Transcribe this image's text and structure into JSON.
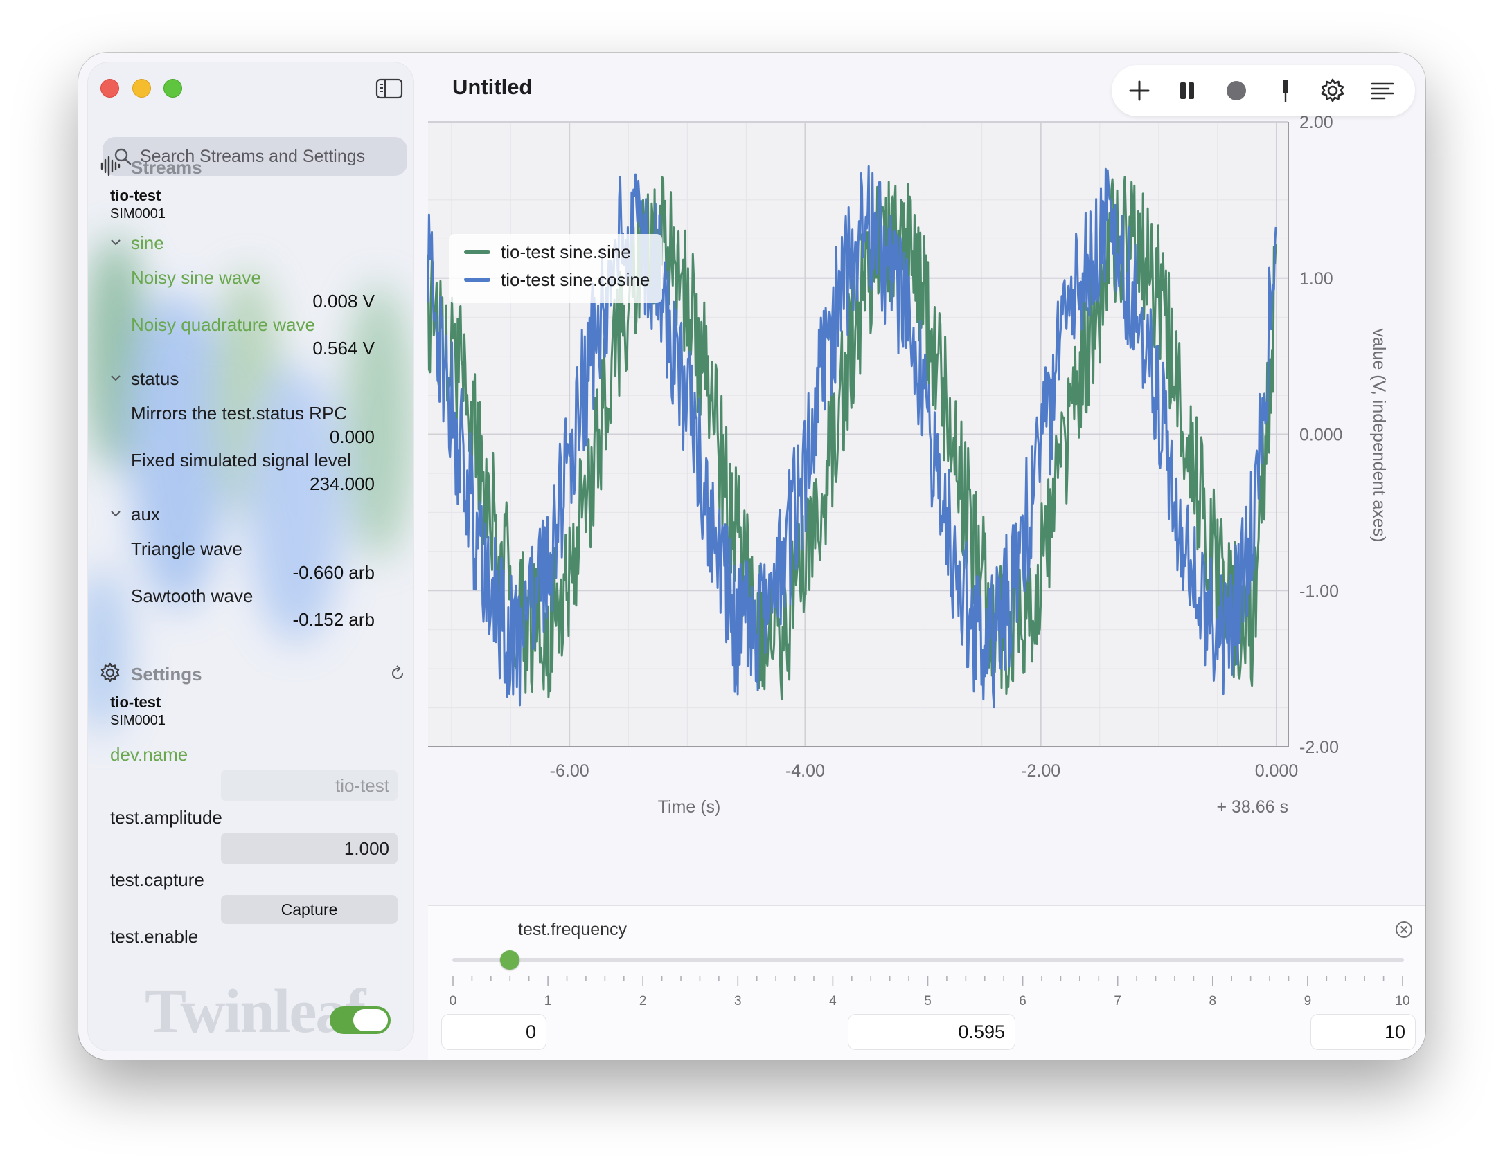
{
  "window": {
    "title": "Untitled"
  },
  "search": {
    "placeholder": "Search Streams and Settings"
  },
  "icons": {
    "sidebar_toggle": "sidebar-toggle-icon",
    "search": "magnifier-icon",
    "streams": "waveform-icon",
    "settings": "gear-icon",
    "refresh": "refresh-icon",
    "add": "plus-icon",
    "pause": "pause-icon",
    "record": "record-icon",
    "probe": "probe-icon",
    "gear": "gear-icon",
    "menu": "lines-icon",
    "close": "close-circle-icon"
  },
  "streams": {
    "heading": "Streams",
    "device_name": "tio-test",
    "device_id": "SIM0001",
    "groups": [
      {
        "name": "sine",
        "expanded": true,
        "items": [
          {
            "label": "Noisy sine wave",
            "value": "0.008 V"
          },
          {
            "label": "Noisy quadrature wave",
            "value": "0.564 V"
          }
        ]
      },
      {
        "name": "status",
        "expanded": true,
        "items": [
          {
            "label": "Mirrors the test.status RPC",
            "value": "0.000"
          },
          {
            "label": "Fixed simulated signal level",
            "value": "234.000"
          }
        ]
      },
      {
        "name": "aux",
        "expanded": true,
        "items": [
          {
            "label": "Triangle wave",
            "value": "-0.660 arb"
          },
          {
            "label": "Sawtooth wave",
            "value": "-0.152 arb"
          }
        ]
      }
    ]
  },
  "settings": {
    "heading": "Settings",
    "device_name": "tio-test",
    "device_id": "SIM0001",
    "fields": [
      {
        "name": "dev.name",
        "value": "tio-test"
      },
      {
        "name": "test.amplitude",
        "value": "1.000"
      },
      {
        "name": "test.capture",
        "button": "Capture"
      },
      {
        "name": "test.enable",
        "toggle": true
      }
    ]
  },
  "watermark": "Twinleaf",
  "colors": {
    "sine": "#4c8a6a",
    "cosine": "#4f7bc8",
    "accent_green": "#6aa84f"
  },
  "chart_data": {
    "type": "line",
    "xlabel": "Time (s)",
    "ylabel": "value (V, independent axes)",
    "x_offset_label": "+ 38.66 s",
    "xlim": [
      -7.2,
      0.1
    ],
    "ylim": [
      -2.0,
      2.0
    ],
    "x_ticks": [
      "-6.00",
      "-4.00",
      "-2.00",
      "0.000"
    ],
    "y_ticks": [
      "2.00",
      "1.00",
      "0.000",
      "-1.00",
      "-2.00"
    ],
    "grid": true,
    "legend_position": "top-left",
    "series": [
      {
        "name": "tio-test sine.sine",
        "color": "#4c8a6a",
        "x": [
          -7.2,
          -7.0,
          -6.8,
          -6.6,
          -6.4,
          -6.2,
          -6.0,
          -5.8,
          -5.6,
          -5.4,
          -5.2,
          -5.0,
          -4.8,
          -4.6,
          -4.4,
          -4.2,
          -4.0,
          -3.8,
          -3.6,
          -3.4,
          -3.2,
          -3.0,
          -2.8,
          -2.6,
          -2.4,
          -2.2,
          -2.0,
          -1.8,
          -1.6,
          -1.4,
          -1.2,
          -1.0,
          -0.8,
          -0.6,
          -0.4,
          -0.2,
          0.0
        ],
        "y": [
          0.8,
          0.6,
          0.0,
          -0.7,
          -1.2,
          -1.3,
          -0.9,
          -0.2,
          0.6,
          1.2,
          1.3,
          0.9,
          0.2,
          -0.6,
          -1.2,
          -1.3,
          -0.9,
          -0.2,
          0.6,
          1.2,
          1.3,
          0.9,
          0.2,
          -0.6,
          -1.2,
          -1.3,
          -0.9,
          -0.1,
          0.6,
          1.2,
          1.3,
          0.9,
          0.2,
          -0.6,
          -1.1,
          -1.2,
          1.0
        ]
      },
      {
        "name": "tio-test sine.cosine",
        "color": "#4f7bc8",
        "x": [
          -7.2,
          -7.0,
          -6.8,
          -6.6,
          -6.4,
          -6.2,
          -6.0,
          -5.8,
          -5.6,
          -5.4,
          -5.2,
          -5.0,
          -4.8,
          -4.6,
          -4.4,
          -4.2,
          -4.0,
          -3.8,
          -3.6,
          -3.4,
          -3.2,
          -3.0,
          -2.8,
          -2.6,
          -2.4,
          -2.2,
          -2.0,
          -1.8,
          -1.6,
          -1.4,
          -1.2,
          -1.0,
          -0.8,
          -0.6,
          -0.4,
          -0.2,
          0.0
        ],
        "y": [
          1.0,
          0.2,
          -0.6,
          -1.2,
          -1.3,
          -0.9,
          -0.2,
          0.6,
          1.2,
          1.3,
          0.9,
          0.2,
          -0.6,
          -1.2,
          -1.3,
          -0.9,
          -0.2,
          0.6,
          1.2,
          1.3,
          0.9,
          0.2,
          -0.6,
          -1.2,
          -1.3,
          -0.9,
          -0.1,
          0.6,
          1.2,
          1.3,
          0.9,
          0.2,
          -0.6,
          -1.2,
          -1.3,
          -0.6,
          1.2
        ]
      }
    ]
  },
  "frequency_slider": {
    "label": "test.frequency",
    "min": 0,
    "max": 10,
    "value": 0.595,
    "tick_labels": [
      "0",
      "1",
      "2",
      "3",
      "4",
      "5",
      "6",
      "7",
      "8",
      "9",
      "10"
    ],
    "min_field": "0",
    "value_field": "0.595",
    "max_field": "10"
  }
}
